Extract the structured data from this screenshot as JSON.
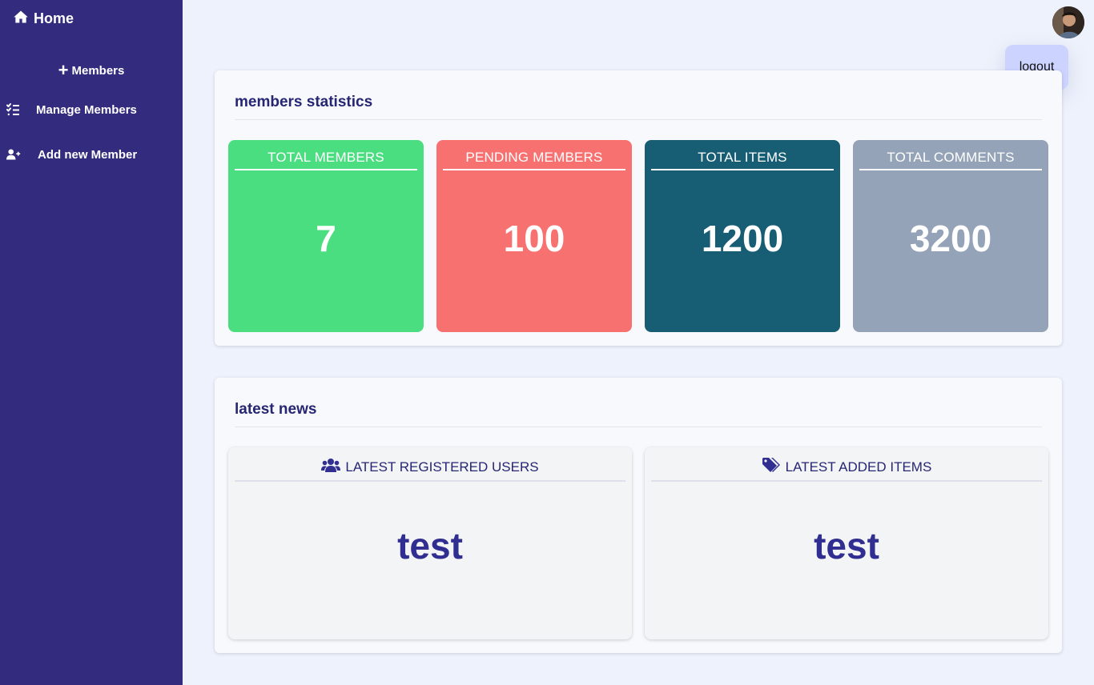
{
  "sidebar": {
    "home_label": "Home",
    "section_label": "Members",
    "items": [
      {
        "label": "Manage Members",
        "icon": "list-check-icon"
      },
      {
        "label": "Add new Member",
        "icon": "user-plus-icon"
      }
    ]
  },
  "header": {
    "logout_label": "logout"
  },
  "stats": {
    "title": "members statistics",
    "cards": [
      {
        "label": "TOTAL MEMBERS",
        "value": "7",
        "color": "#4ade80"
      },
      {
        "label": "PENDING MEMBERS",
        "value": "100",
        "color": "#f87171"
      },
      {
        "label": "TOTAL ITEMS",
        "value": "1200",
        "color": "#175e75"
      },
      {
        "label": "TOTAL COMMENTS",
        "value": "3200",
        "color": "#94a3b8"
      }
    ]
  },
  "news": {
    "title": "latest news",
    "cards": [
      {
        "label": "LATEST REGISTERED USERS",
        "value": "test",
        "icon": "users-icon"
      },
      {
        "label": "LATEST ADDED ITEMS",
        "value": "test",
        "icon": "tags-icon"
      }
    ]
  },
  "colors": {
    "sidebar_bg": "#332c7e",
    "page_bg": "#eef2fc",
    "accent_text": "#262673",
    "logout_bg": "#ccd3fe"
  }
}
